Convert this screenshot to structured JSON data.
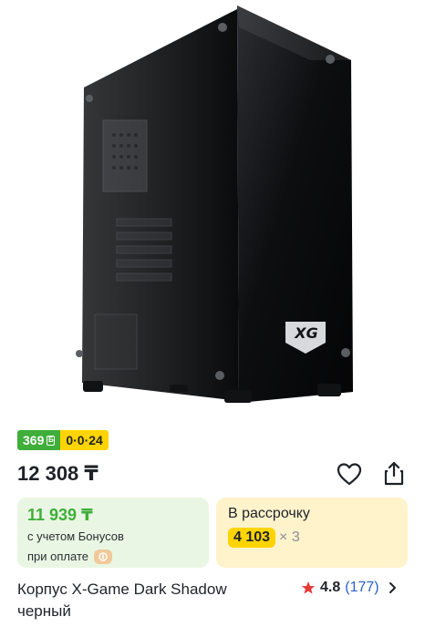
{
  "product": {
    "image_alt": "X-Game Dark Shadow black computer case",
    "logo_text": "XG",
    "badges": {
      "bonus": "369",
      "installment": "0·0·24"
    },
    "price": "12 308 ₸",
    "bonus_card": {
      "amount": "11 939 ₸",
      "line1": "с учетом Бонусов",
      "line2": "при оплате"
    },
    "installment_card": {
      "label": "В рассрочку",
      "monthly": "4 103",
      "multiplier": "× 3"
    },
    "title": "Корпус X-Game Dark Shadow черный",
    "rating": {
      "score": "4.8",
      "count": "(177)"
    }
  },
  "colors": {
    "green": "#3fae3a",
    "yellow": "#ffd400",
    "link": "#2a62c9",
    "star": "#e53935"
  }
}
